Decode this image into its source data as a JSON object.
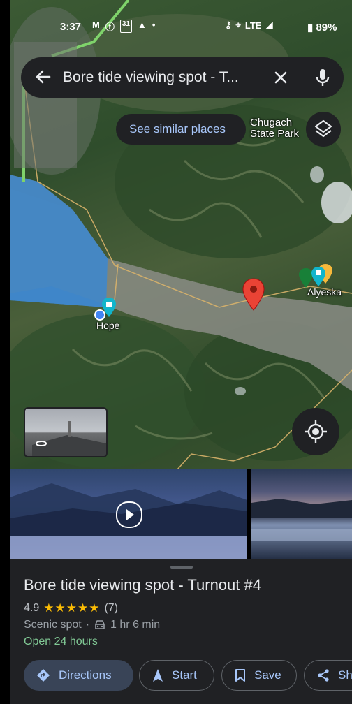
{
  "status_bar": {
    "time": "3:37",
    "left_icons": [
      "gmail-icon",
      "facebook-icon",
      "calendar-icon",
      "android-icon",
      "dot-icon"
    ],
    "network": "LTE",
    "battery": "89%"
  },
  "search": {
    "query": "Bore tide viewing spot - T..."
  },
  "map": {
    "similar_places_label": "See similar places",
    "labels": {
      "chugach_line1": "Chugach",
      "chugach_line2": "State Park",
      "alyeska": "Alyeska",
      "hope": "Hope"
    }
  },
  "place": {
    "title": "Bore tide viewing spot - Turnout #4",
    "rating": "4.9",
    "stars": "★★★★★",
    "review_count": "(7)",
    "category": "Scenic spot",
    "separator": "·",
    "drive_time": "1 hr 6 min",
    "hours": "Open 24 hours"
  },
  "actions": {
    "directions": "Directions",
    "start": "Start",
    "save": "Save",
    "share": "Sh"
  },
  "colors": {
    "accent": "#a8c7fa",
    "open_green": "#81c995",
    "star_yellow": "#fbbc04",
    "pin_red": "#ea4335",
    "sheet_bg": "#202124"
  }
}
